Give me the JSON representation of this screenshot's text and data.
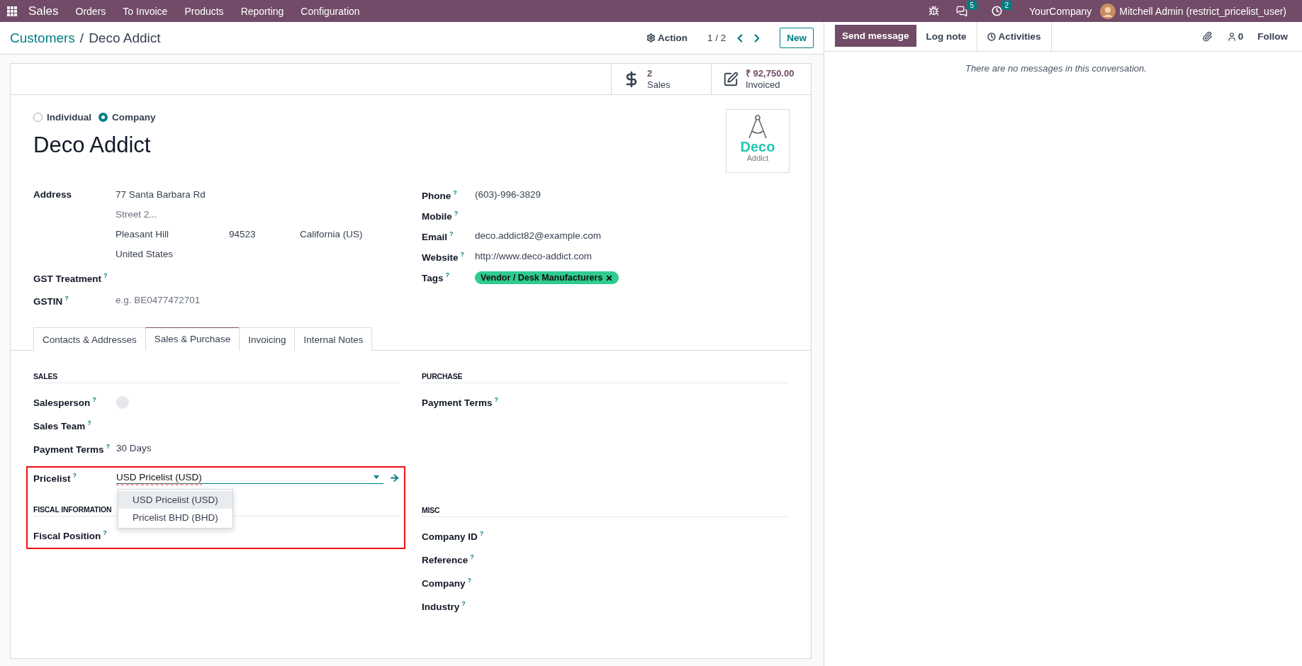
{
  "navbar": {
    "app": "Sales",
    "menu": [
      "Orders",
      "To Invoice",
      "Products",
      "Reporting",
      "Configuration"
    ],
    "messages_badge": "5",
    "activities_badge": "2",
    "company": "YourCompany",
    "user": "Mitchell Admin (restrict_pricelist_user)"
  },
  "breadcrumb": {
    "parent": "Customers",
    "separator": "/",
    "current": "Deco Addict"
  },
  "actions": {
    "action": "Action",
    "pager": "1 / 2",
    "new": "New"
  },
  "stat_buttons": [
    {
      "kind": "sales",
      "value": "2",
      "label": "Sales"
    },
    {
      "kind": "invoiced",
      "value": "₹ 92,750.00",
      "label": "Invoiced"
    }
  ],
  "company_type": [
    {
      "label": "Individual",
      "selected": false
    },
    {
      "label": "Company",
      "selected": true
    }
  ],
  "name": "Deco Addict",
  "logo": {
    "word": "Deco",
    "sub": "Addict"
  },
  "address": {
    "label": "Address",
    "street": "77 Santa Barbara Rd",
    "street2_placeholder": "Street 2...",
    "city": "Pleasant Hill",
    "zip": "94523",
    "state": "California (US)",
    "country": "United States"
  },
  "left_fields": [
    {
      "label": "GST Treatment",
      "help": "?"
    },
    {
      "label": "GSTIN",
      "help": "?",
      "placeholder": "e.g. BE0477472701"
    }
  ],
  "contact_fields": [
    {
      "label": "Phone",
      "help": "?",
      "value": "(603)-996-3829"
    },
    {
      "label": "Mobile",
      "help": "?"
    },
    {
      "label": "Email",
      "help": "?",
      "value": "deco.addict82@example.com"
    },
    {
      "label": "Website",
      "help": "?",
      "value": "http://www.deco-addict.com"
    },
    {
      "label": "Tags",
      "help": "?",
      "tags": [
        {
          "label": "Vendor / Desk Manufacturers",
          "color": "#2ecc8f"
        }
      ]
    }
  ],
  "tabs": [
    {
      "label": "Contacts & Addresses",
      "selected": false
    },
    {
      "label": "Sales & Purchase",
      "selected": true
    },
    {
      "label": "Invoicing",
      "selected": false
    },
    {
      "label": "Internal Notes",
      "selected": false
    }
  ],
  "sales": {
    "title": "SALES",
    "fields": [
      {
        "label": "Salesperson",
        "help": "?",
        "kind": "avatar"
      },
      {
        "label": "Sales Team",
        "help": "?",
        "kind": "text"
      },
      {
        "label": "Payment Terms",
        "help": "?",
        "kind": "text",
        "value": "30 Days"
      }
    ]
  },
  "pricelist": {
    "label": "Pricelist",
    "help": "?",
    "value": "USD Pricelist (USD)",
    "highlighted": true,
    "expanded": true,
    "options": [
      {
        "label": "USD Pricelist (USD)",
        "selected": true
      },
      {
        "label": "Pricelist BHD (BHD)",
        "selected": false
      }
    ]
  },
  "fiscal": {
    "title": "FISCAL INFORMATION",
    "fields": [
      {
        "label": "Fiscal Position",
        "help": "?"
      }
    ]
  },
  "purchase": {
    "title": "PURCHASE",
    "fields": [
      {
        "label": "Payment Terms",
        "help": "?"
      }
    ]
  },
  "misc": {
    "title": "MISC",
    "fields": [
      {
        "label": "Company ID",
        "help": "?"
      },
      {
        "label": "Reference",
        "help": "?"
      },
      {
        "label": "Company",
        "help": "?"
      },
      {
        "label": "Industry",
        "help": "?"
      }
    ]
  },
  "chatter": {
    "send": "Send message",
    "log": "Log note",
    "activities": "Activities",
    "followers": "0",
    "follow": "Follow",
    "empty": "There are no messages in this conversation."
  }
}
